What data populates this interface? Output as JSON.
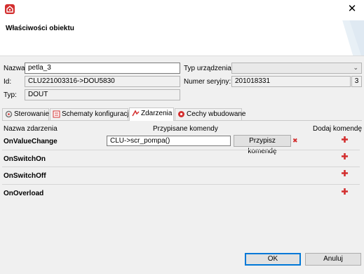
{
  "window": {
    "title": "Właściwości obiektu"
  },
  "form": {
    "name_label": "Nazwa:",
    "name_value": "petla_3",
    "id_label": "Id:",
    "id_value": "CLU221003316->DOU5830",
    "type_label": "Typ:",
    "type_value": "DOUT",
    "device_type_label": "Typ urządzenia:",
    "device_type_value": "",
    "serial_label": "Numer seryjny:",
    "serial_value": "201018331",
    "serial_extra": "3"
  },
  "tabs": [
    {
      "label": "Sterowanie",
      "icon": "steering-icon",
      "active": false
    },
    {
      "label": "Schematy konfiguracji",
      "icon": "schema-icon",
      "active": false
    },
    {
      "label": "Zdarzenia",
      "icon": "events-icon",
      "active": true
    },
    {
      "label": "Cechy wbudowane",
      "icon": "features-icon",
      "active": false
    }
  ],
  "events": {
    "headers": {
      "name": "Nazwa zdarzenia",
      "commands": "Przypisane komendy",
      "add": "Dodaj komendę"
    },
    "rows": [
      {
        "name": "OnValueChange",
        "command": "CLU->scr_pompa()",
        "assign_label": "Przypisz komendę"
      },
      {
        "name": "OnSwitchOn"
      },
      {
        "name": "OnSwitchOff"
      },
      {
        "name": "OnOverload"
      }
    ]
  },
  "footer": {
    "ok_label": "OK",
    "cancel_label": "Anuluj"
  },
  "colors": {
    "accent": "#0078d7",
    "brand_red": "#d32f2f"
  }
}
